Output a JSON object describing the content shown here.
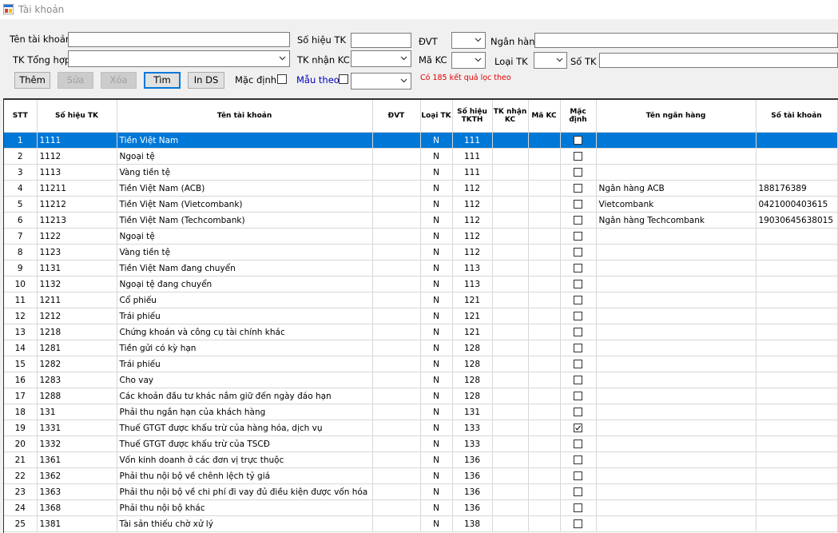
{
  "window": {
    "title": "Tài khoản"
  },
  "filters": {
    "ten_tai_khoan_label": "Tên tài khoản",
    "so_hieu_tk_label": "Số hiệu TK",
    "dvt_label": "ĐVT",
    "ngan_hang_label": "Ngân hàng",
    "tk_tong_hop_label": "TK Tổng hợp",
    "tk_nhan_kc_label": "TK nhận KC",
    "ma_kc_label": "Mã KC",
    "loai_tk_label": "Loại TK",
    "so_tk_label": "Số TK",
    "mac_dinh_label": "Mặc định",
    "mau_theo_label": "Mẫu theo",
    "result_text": "Có 185 kết quả lọc theo",
    "values": {
      "ten_tai_khoan": "",
      "so_hieu_tk": "",
      "dvt": "",
      "ngan_hang": "",
      "tk_tong_hop": "",
      "tk_nhan_kc": "",
      "ma_kc": "",
      "loai_tk": "",
      "so_tk": "",
      "mau_theo": ""
    }
  },
  "buttons": {
    "them": "Thêm",
    "sua": "Sửa",
    "xoa": "Xóa",
    "tim": "Tìm",
    "in_ds": "In DS"
  },
  "colors": {
    "selection": "#0078d7",
    "result_text": "#e00000",
    "mau_theo": "#0000c0"
  },
  "grid": {
    "columns": [
      "STT",
      "Số hiệu TK",
      "Tên tài khoản",
      "ĐVT",
      "Loại TK",
      "Số hiệu TKTH",
      "TK nhận KC",
      "Mã KC",
      "Mặc định",
      "Tên ngân hàng",
      "Số tài khoản"
    ],
    "selected_row": 0,
    "rows": [
      {
        "stt": "1",
        "so_hieu": "1111",
        "ten": "Tiền Việt Nam",
        "dvt": "",
        "loai": "N",
        "tkth": "111",
        "nhan_kc": "",
        "ma_kc": "",
        "mac_dinh": false,
        "ngan_hang": "",
        "so_tk": ""
      },
      {
        "stt": "2",
        "so_hieu": "1112",
        "ten": "Ngoại tệ",
        "dvt": "",
        "loai": "N",
        "tkth": "111",
        "nhan_kc": "",
        "ma_kc": "",
        "mac_dinh": false,
        "ngan_hang": "",
        "so_tk": ""
      },
      {
        "stt": "3",
        "so_hieu": "1113",
        "ten": "Vàng tiền tệ",
        "dvt": "",
        "loai": "N",
        "tkth": "111",
        "nhan_kc": "",
        "ma_kc": "",
        "mac_dinh": false,
        "ngan_hang": "",
        "so_tk": ""
      },
      {
        "stt": "4",
        "so_hieu": "11211",
        "ten": "Tiền Việt Nam (ACB)",
        "dvt": "",
        "loai": "N",
        "tkth": "112",
        "nhan_kc": "",
        "ma_kc": "",
        "mac_dinh": false,
        "ngan_hang": "Ngân hàng ACB",
        "so_tk": "188176389"
      },
      {
        "stt": "5",
        "so_hieu": "11212",
        "ten": "Tiền Việt Nam (Vietcombank)",
        "dvt": "",
        "loai": "N",
        "tkth": "112",
        "nhan_kc": "",
        "ma_kc": "",
        "mac_dinh": false,
        "ngan_hang": "Vietcombank",
        "so_tk": "0421000403615"
      },
      {
        "stt": "6",
        "so_hieu": "11213",
        "ten": "Tiền Việt Nam (Techcombank)",
        "dvt": "",
        "loai": "N",
        "tkth": "112",
        "nhan_kc": "",
        "ma_kc": "",
        "mac_dinh": false,
        "ngan_hang": "Ngân hàng Techcombank",
        "so_tk": "19030645638015"
      },
      {
        "stt": "7",
        "so_hieu": "1122",
        "ten": "Ngoại tệ",
        "dvt": "",
        "loai": "N",
        "tkth": "112",
        "nhan_kc": "",
        "ma_kc": "",
        "mac_dinh": false,
        "ngan_hang": "",
        "so_tk": ""
      },
      {
        "stt": "8",
        "so_hieu": "1123",
        "ten": "Vàng tiền tệ",
        "dvt": "",
        "loai": "N",
        "tkth": "112",
        "nhan_kc": "",
        "ma_kc": "",
        "mac_dinh": false,
        "ngan_hang": "",
        "so_tk": ""
      },
      {
        "stt": "9",
        "so_hieu": "1131",
        "ten": "Tiền Việt Nam đang chuyển",
        "dvt": "",
        "loai": "N",
        "tkth": "113",
        "nhan_kc": "",
        "ma_kc": "",
        "mac_dinh": false,
        "ngan_hang": "",
        "so_tk": ""
      },
      {
        "stt": "10",
        "so_hieu": "1132",
        "ten": "Ngoại tệ đang chuyển",
        "dvt": "",
        "loai": "N",
        "tkth": "113",
        "nhan_kc": "",
        "ma_kc": "",
        "mac_dinh": false,
        "ngan_hang": "",
        "so_tk": ""
      },
      {
        "stt": "11",
        "so_hieu": "1211",
        "ten": "Cổ phiếu",
        "dvt": "",
        "loai": "N",
        "tkth": "121",
        "nhan_kc": "",
        "ma_kc": "",
        "mac_dinh": false,
        "ngan_hang": "",
        "so_tk": ""
      },
      {
        "stt": "12",
        "so_hieu": "1212",
        "ten": "Trái phiếu",
        "dvt": "",
        "loai": "N",
        "tkth": "121",
        "nhan_kc": "",
        "ma_kc": "",
        "mac_dinh": false,
        "ngan_hang": "",
        "so_tk": ""
      },
      {
        "stt": "13",
        "so_hieu": "1218",
        "ten": "Chứng khoán và công cụ tài chính khác",
        "dvt": "",
        "loai": "N",
        "tkth": "121",
        "nhan_kc": "",
        "ma_kc": "",
        "mac_dinh": false,
        "ngan_hang": "",
        "so_tk": ""
      },
      {
        "stt": "14",
        "so_hieu": "1281",
        "ten": "Tiền gửi có kỳ hạn",
        "dvt": "",
        "loai": "N",
        "tkth": "128",
        "nhan_kc": "",
        "ma_kc": "",
        "mac_dinh": false,
        "ngan_hang": "",
        "so_tk": ""
      },
      {
        "stt": "15",
        "so_hieu": "1282",
        "ten": "Trái phiếu",
        "dvt": "",
        "loai": "N",
        "tkth": "128",
        "nhan_kc": "",
        "ma_kc": "",
        "mac_dinh": false,
        "ngan_hang": "",
        "so_tk": ""
      },
      {
        "stt": "16",
        "so_hieu": "1283",
        "ten": "Cho vay",
        "dvt": "",
        "loai": "N",
        "tkth": "128",
        "nhan_kc": "",
        "ma_kc": "",
        "mac_dinh": false,
        "ngan_hang": "",
        "so_tk": ""
      },
      {
        "stt": "17",
        "so_hieu": "1288",
        "ten": "Các khoản đầu tư khác nắm giữ đến ngày đáo hạn",
        "dvt": "",
        "loai": "N",
        "tkth": "128",
        "nhan_kc": "",
        "ma_kc": "",
        "mac_dinh": false,
        "ngan_hang": "",
        "so_tk": ""
      },
      {
        "stt": "18",
        "so_hieu": "131",
        "ten": "Phải thu ngắn hạn của khách hàng",
        "dvt": "",
        "loai": "N",
        "tkth": "131",
        "nhan_kc": "",
        "ma_kc": "",
        "mac_dinh": false,
        "ngan_hang": "",
        "so_tk": ""
      },
      {
        "stt": "19",
        "so_hieu": "1331",
        "ten": "Thuế GTGT được khấu trừ của hàng hóa, dịch vụ",
        "dvt": "",
        "loai": "N",
        "tkth": "133",
        "nhan_kc": "",
        "ma_kc": "",
        "mac_dinh": true,
        "ngan_hang": "",
        "so_tk": ""
      },
      {
        "stt": "20",
        "so_hieu": "1332",
        "ten": "Thuế GTGT được khấu trừ của TSCĐ",
        "dvt": "",
        "loai": "N",
        "tkth": "133",
        "nhan_kc": "",
        "ma_kc": "",
        "mac_dinh": false,
        "ngan_hang": "",
        "so_tk": ""
      },
      {
        "stt": "21",
        "so_hieu": "1361",
        "ten": "Vốn kinh doanh ở các đơn vị trực thuộc",
        "dvt": "",
        "loai": "N",
        "tkth": "136",
        "nhan_kc": "",
        "ma_kc": "",
        "mac_dinh": false,
        "ngan_hang": "",
        "so_tk": ""
      },
      {
        "stt": "22",
        "so_hieu": "1362",
        "ten": "Phải thu nội bộ về chênh lệch tỷ giá",
        "dvt": "",
        "loai": "N",
        "tkth": "136",
        "nhan_kc": "",
        "ma_kc": "",
        "mac_dinh": false,
        "ngan_hang": "",
        "so_tk": ""
      },
      {
        "stt": "23",
        "so_hieu": "1363",
        "ten": "Phải thu nội bộ về chi phí đi vay đủ điều kiện được vốn hóa",
        "dvt": "",
        "loai": "N",
        "tkth": "136",
        "nhan_kc": "",
        "ma_kc": "",
        "mac_dinh": false,
        "ngan_hang": "",
        "so_tk": ""
      },
      {
        "stt": "24",
        "so_hieu": "1368",
        "ten": "Phải thu nội bộ khác",
        "dvt": "",
        "loai": "N",
        "tkth": "136",
        "nhan_kc": "",
        "ma_kc": "",
        "mac_dinh": false,
        "ngan_hang": "",
        "so_tk": ""
      },
      {
        "stt": "25",
        "so_hieu": "1381",
        "ten": "Tài sản thiếu chờ xử lý",
        "dvt": "",
        "loai": "N",
        "tkth": "138",
        "nhan_kc": "",
        "ma_kc": "",
        "mac_dinh": false,
        "ngan_hang": "",
        "so_tk": ""
      }
    ]
  }
}
